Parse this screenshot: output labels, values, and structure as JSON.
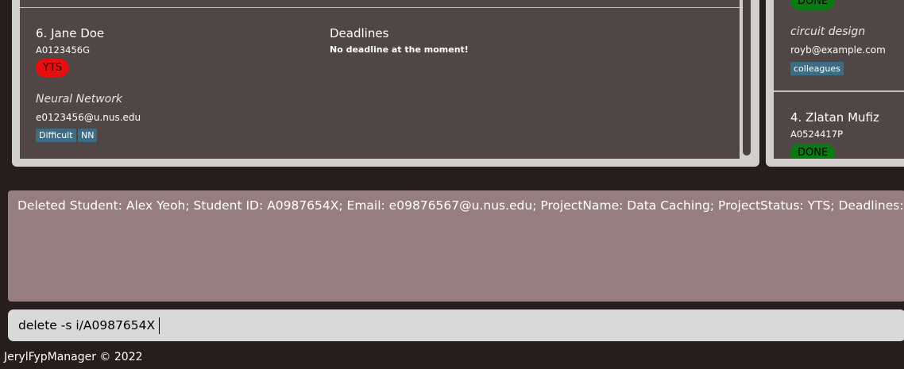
{
  "student_list": {
    "card": {
      "index_name": "6.  Jane Doe",
      "student_id": "A0123456G",
      "status": "YTS",
      "project": "Neural Network",
      "email": "e0123456@u.nus.edu",
      "tags": [
        "Difficult",
        "NN"
      ],
      "deadlines_title": "Deadlines",
      "deadlines_empty": "No deadline at the moment!"
    }
  },
  "right_list": {
    "card_top": {
      "status": "DONE",
      "project": "circuit design",
      "email": "royb@example.com",
      "tags": [
        "colleagues"
      ]
    },
    "card_bottom": {
      "index_name": "4.  Zlatan Mufiz",
      "student_id": "A0524417P",
      "status": "DONE"
    }
  },
  "result_display": {
    "text": "Deleted Student: Alex Yeoh; Student ID: A0987654X; Email: e09876567@u.nus.edu; ProjectName: Data Caching; ProjectStatus: YTS; Deadlines: []"
  },
  "command_box": {
    "value": "delete -s i/A0987654X"
  },
  "status_bar": {
    "text": "JerylFypManager © 2022"
  },
  "colors": {
    "background": "#261e1d",
    "card": "#4f4645",
    "result_box": "#967e7e",
    "status_yts": "#e60f0f",
    "status_done": "#0c7a12",
    "tag": "#3d6d85"
  }
}
